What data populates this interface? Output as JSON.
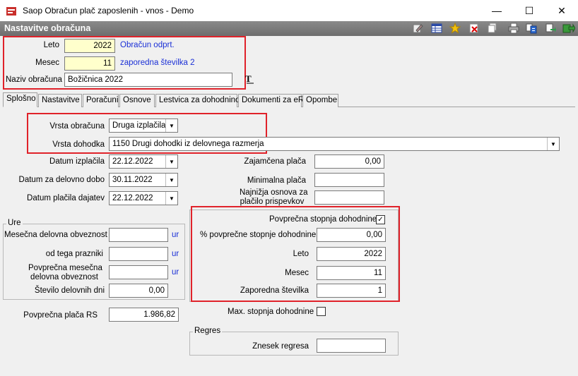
{
  "window": {
    "title": "Saop Obračun plač zaposlenih - vnos - Demo",
    "min": "—",
    "max": "☐",
    "close": "✕"
  },
  "header": {
    "title": "Nastavitve obračuna"
  },
  "toolbar_icons": [
    "edit-icon",
    "table-icon",
    "star-icon",
    "delete-icon",
    "copy-icon",
    "print-icon",
    "export-icon",
    "exit-icon"
  ],
  "top": {
    "leto_label": "Leto",
    "leto_value": "2022",
    "leto_note": "Obračun odprt.",
    "mesec_label": "Mesec",
    "mesec_value": "11",
    "mesec_note": "zaporedna številka 2",
    "naziv_label": "Naziv obračuna",
    "naziv_value": "Božičnica 2022"
  },
  "tabs": [
    "Splošno",
    "Nastavitve",
    "Poračuni",
    "Osnove",
    "Lestvica za dohodnino",
    "Dokumenti za eR",
    "Opombe"
  ],
  "general": {
    "vrsta_obracuna_label": "Vrsta obračuna",
    "vrsta_obracuna_value": "Druga izplačila",
    "vrsta_dohodka_label": "Vrsta dohodka",
    "vrsta_dohodka_value": "1150  Drugi dohodki iz delovnega razmerja",
    "datum_izplacila_label": "Datum izplačila",
    "datum_izplacila_value": "22.12.2022",
    "datum_delovno_label": "Datum za delovno dobo",
    "datum_delovno_value": "30.11.2022",
    "datum_dajatev_label": "Datum plačila dajatev",
    "datum_dajatev_value": "22.12.2022",
    "zajamcena_label": "Zajamčena plača",
    "zajamcena_value": "0,00",
    "minimalna_label": "Minimalna plača",
    "minimalna_value": "",
    "najnizja_label_1": "Najnižja osnova za",
    "najnizja_label_2": "plačilo prispevkov",
    "najnizja_value": ""
  },
  "ure": {
    "title": "Ure",
    "mesecna_label": "Mesečna delovna obveznost",
    "mesecna_value": "",
    "prazniki_label": "od tega prazniki",
    "prazniki_value": "",
    "povprecna_label_1": "Povprečna mesečna",
    "povprecna_label_2": "delovna obveznost",
    "povprecna_value": "",
    "dni_label": "Število delovnih dni",
    "dni_value": "0,00",
    "unit": "ur"
  },
  "placa_rs": {
    "label": "Povprečna plača RS",
    "value": "1.986,82"
  },
  "dohodnina": {
    "checkbox_label": "Povprečna stopnja dohodnine",
    "checkbox_mark": "✓",
    "pct_label": "% povprečne stopnje dohodnine",
    "pct_value": "0,00",
    "leto_label": "Leto",
    "leto_value": "2022",
    "mesec_label": "Mesec",
    "mesec_value": "11",
    "zap_label": "Zaporedna številka",
    "zap_value": "1",
    "max_label": "Max. stopnja dohodnine",
    "max_mark": ""
  },
  "regres": {
    "title": "Regres",
    "label": "Znesek regresa",
    "value": ""
  },
  "colors": {
    "highlight": "#e0222a",
    "note": "#1a2fd6",
    "yellow_field": "#ffffcc"
  }
}
